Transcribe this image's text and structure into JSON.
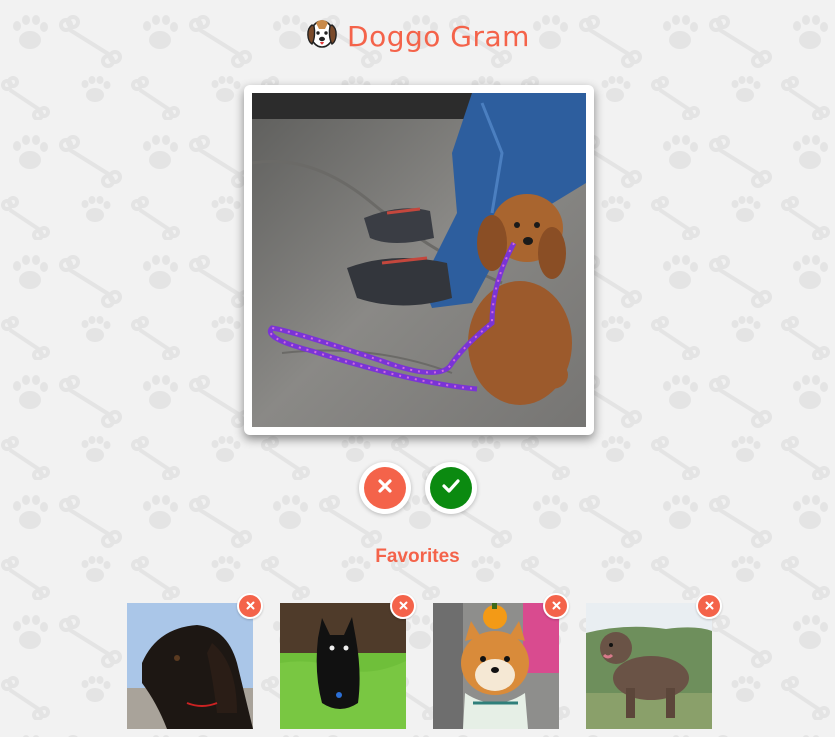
{
  "app": {
    "title": "Doggo Gram",
    "logo_icon": "beagle-dog-icon",
    "accent_color": "#f4634a"
  },
  "current_photo": {
    "alt": "Curly brown puppy with purple leash next to a person's sneakers"
  },
  "actions": {
    "reject": {
      "icon": "close-icon",
      "color": "#f4634a"
    },
    "approve": {
      "icon": "check-icon",
      "color": "#0b8a10"
    }
  },
  "favorites": {
    "title": "Favorites",
    "items": [
      {
        "alt": "Black long-haired setter at the beach",
        "remove_icon": "close-icon"
      },
      {
        "alt": "Small black dog sitting in grass",
        "remove_icon": "close-icon"
      },
      {
        "alt": "Shiba Inu with pumpkin on head",
        "remove_icon": "close-icon"
      },
      {
        "alt": "Brown curly water dog on hillside",
        "remove_icon": "close-icon"
      }
    ]
  }
}
